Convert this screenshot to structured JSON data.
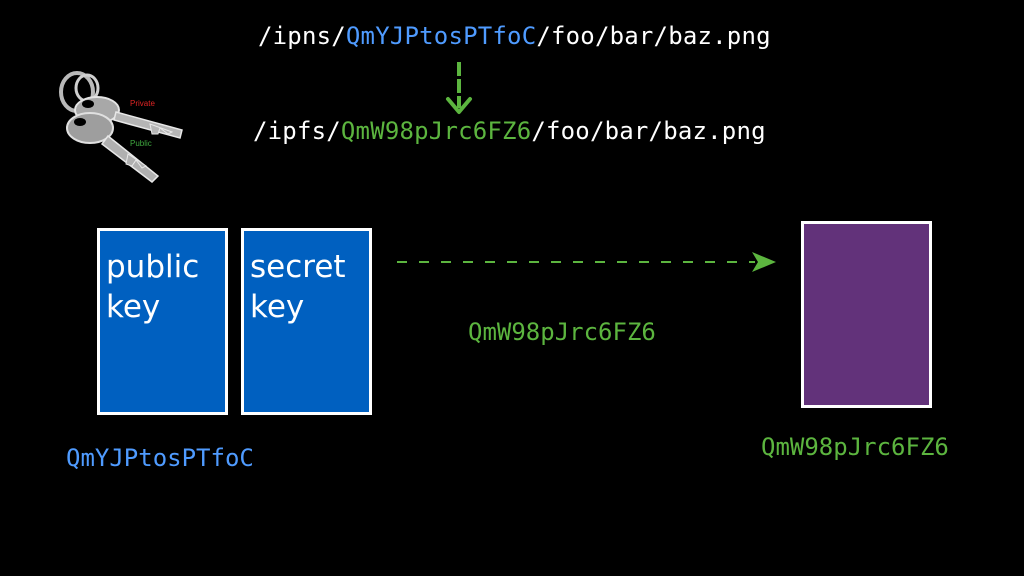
{
  "ipns_path": {
    "prefix": "/ipns/",
    "hash": "QmYJPtosPTfoC",
    "suffix": "/foo/bar/baz.png"
  },
  "ipfs_path": {
    "prefix": "/ipfs/",
    "hash": "QmW98pJrc6FZ6",
    "suffix": "/foo/bar/baz.png"
  },
  "keys_icon": {
    "private_label": "Private",
    "public_label": "Public"
  },
  "public_key_box": {
    "line1": "public",
    "line2": "key"
  },
  "secret_key_box": {
    "line1": "secret",
    "line2": "key"
  },
  "public_key_hash": "QmYJPtosPTfoC",
  "transfer_hash": "QmW98pJrc6FZ6",
  "object_hash": "QmW98pJrc6FZ6",
  "colors": {
    "blue_hash": "#4f9bff",
    "green_hash": "#5cb53f",
    "key_box": "#0060c0",
    "object_box": "#62327a"
  }
}
